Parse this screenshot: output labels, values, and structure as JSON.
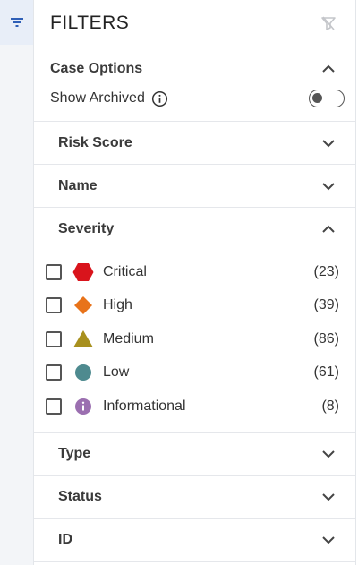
{
  "header": {
    "title": "FILTERS"
  },
  "case_options": {
    "label": "Case Options",
    "show_archived_label": "Show Archived",
    "show_archived_on": false
  },
  "sections": {
    "risk_score": "Risk Score",
    "name": "Name",
    "severity": "Severity",
    "type": "Type",
    "status": "Status",
    "id": "ID"
  },
  "severity_items": [
    {
      "label": "Critical",
      "count": "(23)",
      "color": "#d9141c",
      "icon": "hexagon-icon"
    },
    {
      "label": "High",
      "count": "(39)",
      "color": "#e8731a",
      "icon": "diamond-icon"
    },
    {
      "label": "Medium",
      "count": "(86)",
      "color": "#a8901e",
      "icon": "triangle-icon"
    },
    {
      "label": "Low",
      "count": "(61)",
      "color": "#4e8a8f",
      "icon": "circle-icon"
    },
    {
      "label": "Informational",
      "count": "(8)",
      "color": "#9b6fb0",
      "icon": "info-circle-icon"
    }
  ],
  "colors": {
    "accent": "#2f5fb7",
    "rail_bg": "#f3f5f8"
  }
}
